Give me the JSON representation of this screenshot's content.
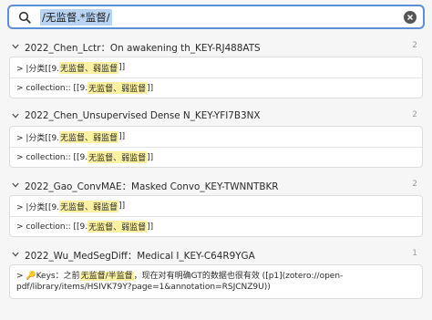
{
  "search": {
    "query": "/无监督.*监督/"
  },
  "groups": [
    {
      "title": "2022_Chen_Lctr：On awakening th_KEY-RJ488ATS",
      "count": "2",
      "items": [
        {
          "prefix": "> |分类[[9. ",
          "match": "无监督、弱监督",
          "suffix": "]]"
        },
        {
          "prefix": "> collection:: [[9. ",
          "match": "无监督、弱监督",
          "suffix": "]]"
        }
      ]
    },
    {
      "title": "2022_Chen_Unsupervised Dense N_KEY-YFI7B3NX",
      "count": "2",
      "items": [
        {
          "prefix": "> |分类[[9. ",
          "match": "无监督、弱监督",
          "suffix": "]]"
        },
        {
          "prefix": "> collection:: [[9. ",
          "match": "无监督、弱监督",
          "suffix": "]]"
        }
      ]
    },
    {
      "title": "2022_Gao_ConvMAE：Masked Convo_KEY-TWNNTBKR",
      "count": "2",
      "items": [
        {
          "prefix": "> |分类[[9. ",
          "match": "无监督、弱监督",
          "suffix": "]]"
        },
        {
          "prefix": "> collection:: [[9. ",
          "match": "无监督、弱监督",
          "suffix": "]]"
        }
      ]
    },
    {
      "title": "2022_Wu_MedSegDiff：Medical I_KEY-C64R9YGA",
      "count": "1",
      "items": [
        {
          "prefix": "> 🔑Keys：之前",
          "match": "无监督/半监督",
          "suffix": "，现在对有明确GT的数据也很有效 ([p1](zotero://open-pdf/library/items/HSIVK79Y?page=1&annotation=RSJCNZ9U))"
        }
      ]
    }
  ]
}
